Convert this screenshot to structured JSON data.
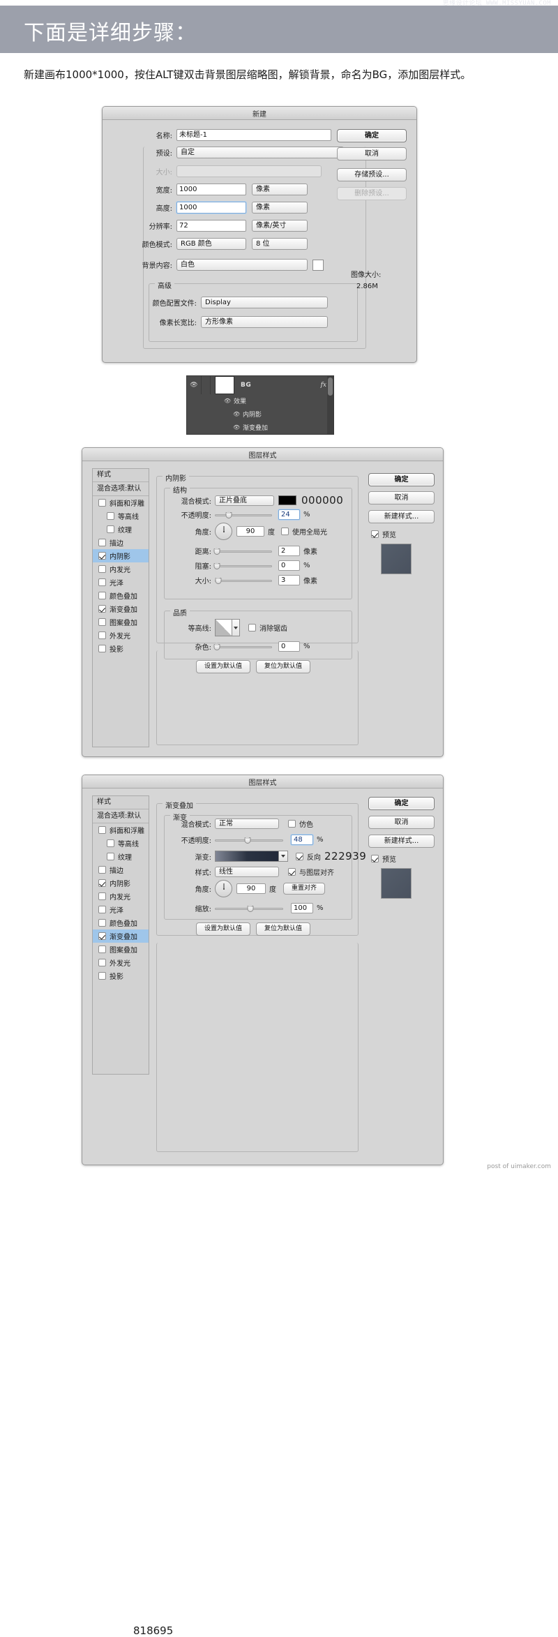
{
  "banner": {
    "title": "下面是详细步骤：",
    "watermark": "思缘设计论坛 WWW.MISSYUAN.COM"
  },
  "intro": "新建画布1000*1000，按住ALT键双击背景图层缩略图，解锁背景，命名为BG，添加图层样式。",
  "new_doc_dialog": {
    "title": "新建",
    "fields": {
      "name_label": "名称:",
      "name_value": "未标题-1",
      "preset_label": "预设:",
      "preset_value": "自定",
      "size_label": "大小:",
      "size_value": "",
      "width_label": "宽度:",
      "width_value": "1000",
      "width_unit": "像素",
      "height_label": "高度:",
      "height_value": "1000",
      "height_unit": "像素",
      "resolution_label": "分辨率:",
      "resolution_value": "72",
      "resolution_unit": "像素/英寸",
      "colormode_label": "颜色模式:",
      "colormode_value": "RGB 颜色",
      "bitdepth_value": "8 位",
      "background_label": "背景内容:",
      "background_value": "白色",
      "advanced_label": "高级",
      "profile_label": "颜色配置文件:",
      "profile_value": "Display",
      "aspect_label": "像素长宽比:",
      "aspect_value": "方形像素"
    },
    "buttons": {
      "ok": "确定",
      "cancel": "取消",
      "save_preset": "存储预设...",
      "delete_preset": "删除预设..."
    },
    "image_size_label": "图像大小:",
    "image_size_value": "2.86M"
  },
  "layers_panel": {
    "layer_name": "BG",
    "fx_badge": "fx",
    "effects_label": "效果",
    "effects": [
      "内阴影",
      "渐变叠加"
    ]
  },
  "layer_style_common": {
    "title": "图层样式",
    "styles_header": "样式",
    "blending_options": "混合选项:默认",
    "style_items": [
      {
        "label": "斜面和浮雕",
        "checked": false,
        "indent": false
      },
      {
        "label": "等高线",
        "checked": false,
        "indent": true
      },
      {
        "label": "纹理",
        "checked": false,
        "indent": true
      },
      {
        "label": "描边",
        "checked": false,
        "indent": false
      },
      {
        "label": "内阴影",
        "checked": true,
        "indent": false
      },
      {
        "label": "内发光",
        "checked": false,
        "indent": false
      },
      {
        "label": "光泽",
        "checked": false,
        "indent": false
      },
      {
        "label": "颜色叠加",
        "checked": false,
        "indent": false
      },
      {
        "label": "渐变叠加",
        "checked": true,
        "indent": false
      },
      {
        "label": "图案叠加",
        "checked": false,
        "indent": false
      },
      {
        "label": "外发光",
        "checked": false,
        "indent": false
      },
      {
        "label": "投影",
        "checked": false,
        "indent": false
      }
    ],
    "buttons": {
      "ok": "确定",
      "cancel": "取消",
      "new_style": "新建样式...",
      "preview": "预览"
    },
    "footer_buttons": {
      "set_default": "设置为默认值",
      "reset_default": "复位为默认值"
    }
  },
  "inner_shadow_dialog": {
    "section_title": "内阴影",
    "structure_label": "结构",
    "blend_mode_label": "混合模式:",
    "blend_mode_value": "正片叠底",
    "color_hex": "000000",
    "opacity_label": "不透明度:",
    "opacity_value": "24",
    "opacity_unit": "%",
    "angle_label": "角度:",
    "angle_value": "90",
    "angle_unit": "度",
    "global_light_label": "使用全局光",
    "global_light_checked": false,
    "distance_label": "距离:",
    "distance_value": "2",
    "distance_unit": "像素",
    "choke_label": "阻塞:",
    "choke_value": "0",
    "choke_unit": "%",
    "size_label": "大小:",
    "size_value": "3",
    "size_unit": "像素",
    "quality_label": "品质",
    "contour_label": "等高线:",
    "antialias_label": "消除锯齿",
    "antialias_checked": false,
    "noise_label": "杂色:",
    "noise_value": "0",
    "noise_unit": "%",
    "selected_style": "内阴影"
  },
  "gradient_overlay_dialog": {
    "section_title": "渐变叠加",
    "gradient_label": "渐变",
    "blend_mode_label": "混合模式:",
    "blend_mode_value": "正常",
    "dither_label": "仿色",
    "dither_checked": false,
    "opacity_label": "不透明度:",
    "opacity_value": "48",
    "opacity_unit": "%",
    "gradient_field_label": "渐变:",
    "gradient_start_hex": "818695",
    "gradient_end_hex": "222939",
    "reverse_label": "反向",
    "reverse_checked": true,
    "style_label": "样式:",
    "style_value": "线性",
    "align_label": "与图层对齐",
    "align_checked": true,
    "angle_label": "角度:",
    "angle_value": "90",
    "angle_unit": "度",
    "reset_align_label": "重置对齐",
    "scale_label": "缩放:",
    "scale_value": "100",
    "scale_unit": "%",
    "selected_style": "渐变叠加"
  },
  "footer_credit": "post of uimaker.com"
}
